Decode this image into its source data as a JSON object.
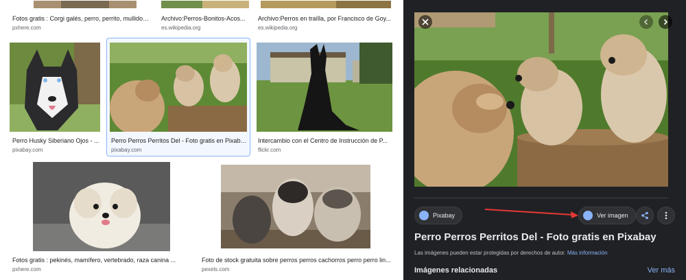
{
  "grid": {
    "row1": [
      {
        "caption": "Fotos gratis : Corgi galés, perro, perrito, mullido,...",
        "domain": "pxhere.com"
      },
      {
        "caption": "Archivo:Perros-Bonitos-Acos...",
        "domain": "es.wikipedia.org"
      },
      {
        "caption": "Archivo:Perros en traílla, por Francisco de Goy...",
        "domain": "es.wikipedia.org"
      }
    ],
    "row2": [
      {
        "caption": "Perro Husky Siberiano Ojos - ...",
        "domain": "pixabay.com"
      },
      {
        "caption": "Perro Perros Perritos Del - Foto gratis en Pixaba...",
        "domain": "pixabay.com"
      },
      {
        "caption": "Intercambio con el Centro de Instrucción de P...",
        "domain": "flickr.com"
      }
    ],
    "row3": [
      {
        "caption": "Fotos gratis : pekinés, mamífero, vertebrado, raza canina ...",
        "domain": "pxhere.com"
      },
      {
        "caption": "Foto de stock gratuita sobre perros perros cachorros perro perro lin...",
        "domain": "pexels.com"
      }
    ]
  },
  "panel": {
    "source_chip": "Pixabay",
    "view_image": "Ver imagen",
    "title": "Perro Perros Perritos Del - Foto gratis en Pixabay",
    "legal_text": "Las imágenes pueden estar protegidas por derechos de autor.",
    "legal_link": "Más información",
    "related_heading": "Imágenes relacionadas",
    "see_more": "Ver más"
  },
  "colors": {
    "panel_bg": "#202124",
    "accent": "#8ab4f8",
    "arrow": "#e53935"
  },
  "icons": [
    "close-icon",
    "chevron-left-icon",
    "chevron-right-icon",
    "globe-icon",
    "share-icon",
    "more-vert-icon"
  ]
}
